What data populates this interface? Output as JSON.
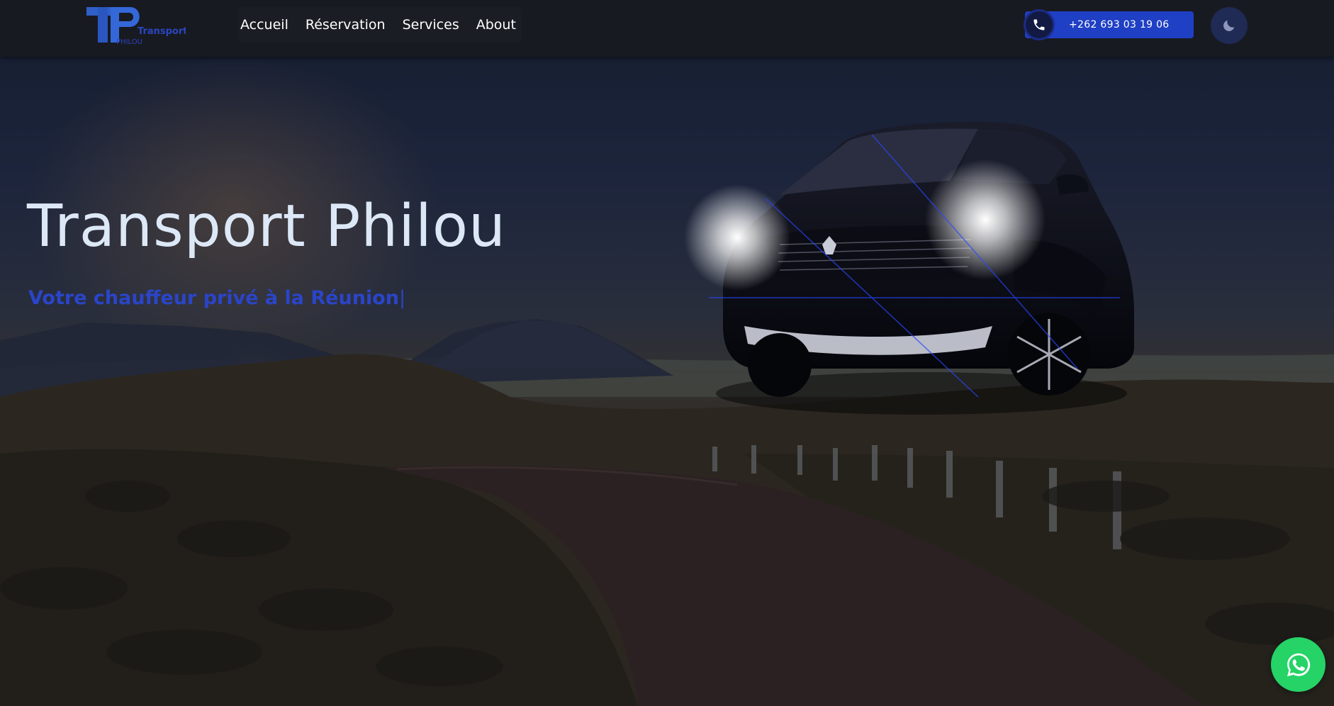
{
  "navbar": {
    "logo": {
      "letters": "TP",
      "word_main": "Transport",
      "word_sub": "PHILOU"
    },
    "menu": [
      {
        "label": "Accueil"
      },
      {
        "label": "Réservation"
      },
      {
        "label": "Services"
      },
      {
        "label": "About"
      }
    ],
    "phone": {
      "number": "+262 693 03 19 06",
      "icon": "phone-icon"
    },
    "theme_toggle": {
      "icon": "moon-icon"
    }
  },
  "hero": {
    "title": "Transport Philou",
    "subtitle": "Votre chauffeur privé à la Réunion",
    "subtitle_caret": "|",
    "background": "mountain-road-sunset-image",
    "car_image": "suv-car-image"
  },
  "floating": {
    "whatsapp_icon": "whatsapp-icon"
  },
  "colors": {
    "navbar_bg": "#181a21",
    "accent_blue": "#1f3fc4",
    "subtitle_blue": "#2a45c8",
    "title_text": "#dde8f7",
    "whatsapp_green": "#25d366",
    "toggle_bg": "#1f2a55"
  }
}
